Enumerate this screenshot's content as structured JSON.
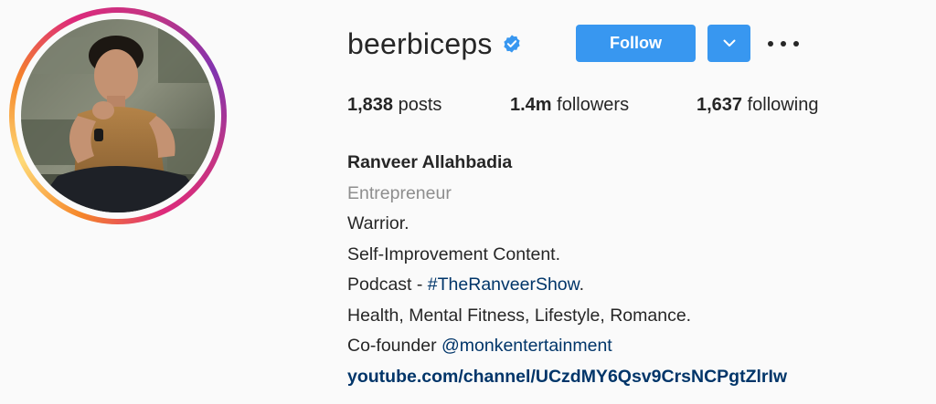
{
  "profile": {
    "username": "beerbiceps",
    "follow_label": "Follow",
    "stats": {
      "posts_count": "1,838",
      "posts_label": " posts",
      "followers_count": "1.4m",
      "followers_label": " followers",
      "following_count": "1,637",
      "following_label": " following"
    },
    "bio": {
      "name": "Ranveer Allahbadia",
      "category": "Entrepreneur",
      "line1": "Warrior.",
      "line2": "Self-Improvement Content.",
      "podcast_prefix": "Podcast - ",
      "podcast_hashtag": "#TheRanveerShow",
      "podcast_suffix": ".",
      "line4": "Health, Mental Fitness, Lifestyle, Romance.",
      "cofounder_prefix": "Co-founder ",
      "cofounder_mention": "@monkentertainment",
      "website": "youtube.com/channel/UCzdMY6Qsv9CrsNCPgtZlrIw"
    }
  },
  "icons": {
    "verified": "verified-badge-icon",
    "dropdown": "chevron-down-icon",
    "more": "more-options-icon"
  },
  "colors": {
    "accent": "#3897f0",
    "link": "#003569",
    "muted": "#8e8e8e",
    "text": "#262626",
    "background": "#fafafa"
  }
}
